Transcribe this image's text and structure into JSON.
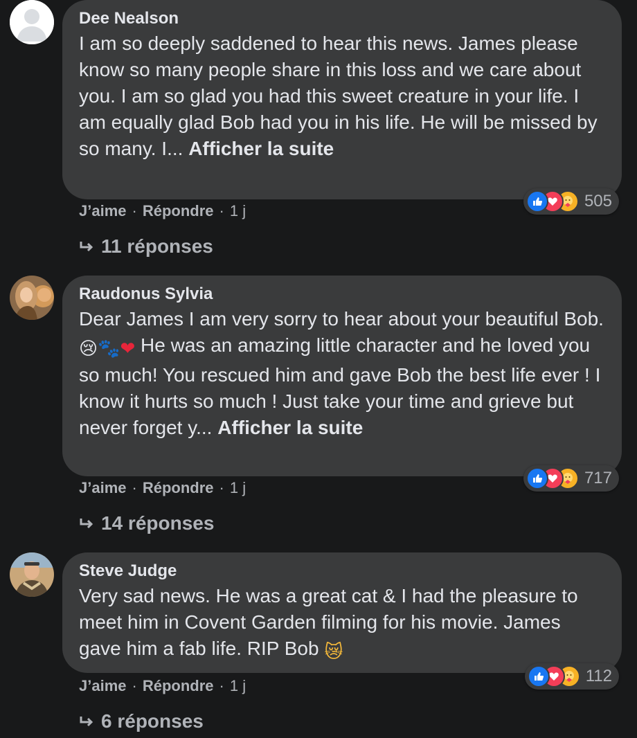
{
  "comments": [
    {
      "author": "Dee Nealson",
      "text": "I am so deeply saddened to hear this news. James please know so many people share in this loss and we care about you. I am so glad you had this sweet creature in your life. I am equally glad Bob had you in his life. He will be missed by so many. I... ",
      "see_more": "Afficher la suite",
      "reaction_count": "505",
      "like_label": "J’aime",
      "reply_label": "Répondre",
      "time": "1 j",
      "replies_label": "11 réponses",
      "avatar": "default-avatar-icon"
    },
    {
      "author": "Raudonus Sylvia",
      "text_before": "Dear James I am very sorry to hear about your beautiful Bob.",
      "emojis": [
        "😢",
        "🐾",
        "❤"
      ],
      "text_after": " He was an amazing little character and he loved you so much! You rescued him and gave Bob the best life ever ! I know it hurts so much ! Just take your time and grieve but never forget y... ",
      "see_more": "Afficher la suite",
      "reaction_count": "717",
      "like_label": "J’aime",
      "reply_label": "Répondre",
      "time": "1 j",
      "replies_label": "14 réponses",
      "avatar": "profile-photo-with-cat"
    },
    {
      "author": "Steve Judge",
      "text": "Very sad news. He was a great cat & I had the pleasure to meet him in Covent Garden filming for his movie. James gave him a fab life. RIP Bob ",
      "emoji": "😿",
      "reaction_count": "112",
      "like_label": "J’aime",
      "reply_label": "Répondre",
      "time": "1 j",
      "replies_label": "6 réponses",
      "avatar": "profile-photo-outdoor"
    }
  ],
  "colors": {
    "background": "#18191a",
    "bubble": "#3a3b3c",
    "text": "#e4e6eb",
    "secondary_text": "#b0b3b8",
    "like": "#1877f2",
    "love": "#f33e58",
    "care": "#f7b125"
  }
}
